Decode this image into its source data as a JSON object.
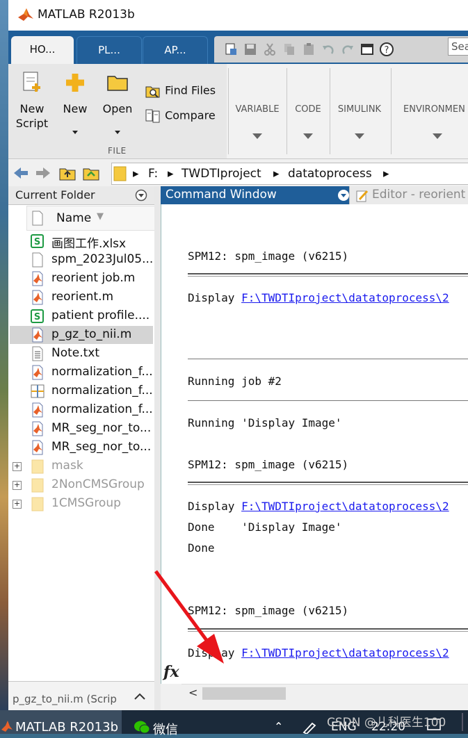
{
  "window": {
    "title": "MATLAB R2013b"
  },
  "tabs": [
    {
      "label": "HO...",
      "active": true
    },
    {
      "label": "PL...",
      "active": false
    },
    {
      "label": "AP...",
      "active": false
    }
  ],
  "search": {
    "placeholder": "Sea"
  },
  "ribbon": {
    "file_group_label": "FILE",
    "new_script_line1": "New",
    "new_script_line2": "Script",
    "new_label": "New",
    "open_label": "Open",
    "find_files_label": "Find Files",
    "compare_label": "Compare",
    "variable_label": "VARIABLE",
    "code_label": "CODE",
    "simulink_label": "SIMULINK",
    "environment_label": "ENVIRONMEN"
  },
  "address": {
    "crumbs": [
      "F:",
      "TWDTIproject",
      "datatoprocess"
    ]
  },
  "current_folder": {
    "title": "Current Folder",
    "name_header": "Name",
    "files": [
      {
        "name": "画图工作.xlsx",
        "icon": "excel-icon"
      },
      {
        "name": "spm_2023Jul05...",
        "icon": "document-icon"
      },
      {
        "name": "reorient job.m",
        "icon": "matlab-file-icon"
      },
      {
        "name": "reorient.m",
        "icon": "matlab-file-icon"
      },
      {
        "name": "patient profile....",
        "icon": "excel-icon"
      },
      {
        "name": "p_gz_to_nii.m",
        "icon": "matlab-file-icon",
        "selected": true
      },
      {
        "name": "Note.txt",
        "icon": "text-file-icon"
      },
      {
        "name": "normalization_f...",
        "icon": "matlab-file-icon"
      },
      {
        "name": "normalization_f...",
        "icon": "grid-file-icon"
      },
      {
        "name": "normalization_f...",
        "icon": "matlab-file-icon"
      },
      {
        "name": "MR_seg_nor_to...",
        "icon": "matlab-file-icon"
      },
      {
        "name": "MR_seg_nor_to...",
        "icon": "matlab-file-icon"
      }
    ],
    "folders": [
      "mask",
      "2NonCMSGroup",
      "1CMSGroup"
    ],
    "detail_label": "p_gz_to_nii.m (Scrip"
  },
  "command_window": {
    "title": "Command Window",
    "editor_tab": "Editor - reorient",
    "lines": {
      "l1": "SPM12: spm_image (v6215)",
      "l2_prefix": "Display ",
      "l2_link": "F:\\TWDTIproject\\datatoprocess\\2",
      "l3": "Running job #2",
      "l4": "Running 'Display Image'",
      "l5": "SPM12: spm_image (v6215)",
      "l6_prefix": "Display ",
      "l6_link": "F:\\TWDTIproject\\datatoprocess\\2",
      "l7": "Done    'Display Image'",
      "l8": "Done",
      "l9": "SPM12: spm_image (v6215)",
      "l10_prefix": "Display ",
      "l10_link": "F:\\TWDTIproject\\datatoprocess\\2"
    },
    "fx": "fx"
  },
  "taskbar": {
    "matlab": "MATLAB R2013b",
    "wechat": "微信",
    "lang": "ENG",
    "time": "22:20"
  },
  "watermark": "CSDN @儿科医生100",
  "colors": {
    "ribbon_blue": "#1f5e99",
    "arrow_red": "#e8151b",
    "link_blue": "#1a1aee"
  }
}
